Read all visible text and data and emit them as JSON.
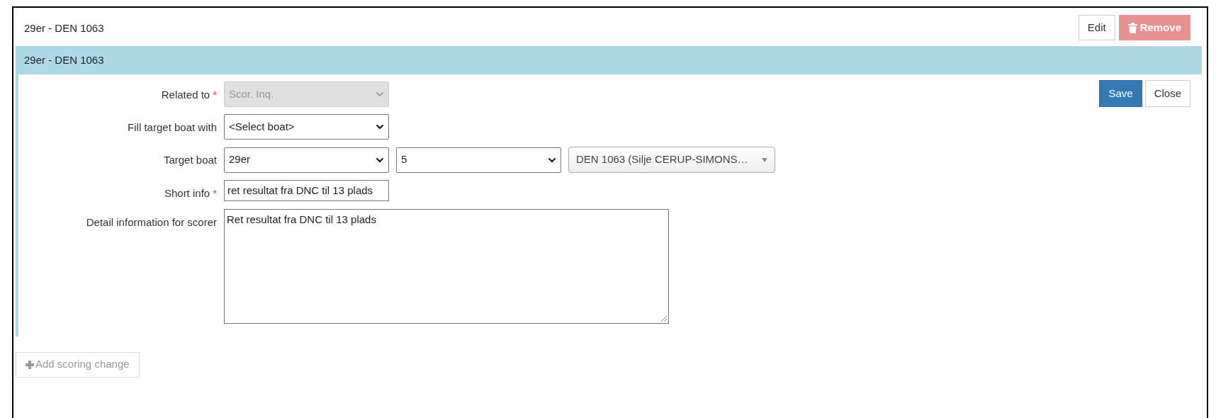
{
  "header": {
    "title": "29er - DEN 1063",
    "buttons": [
      {
        "label": "Edit",
        "kind": "default"
      },
      {
        "label": "Remove",
        "kind": "danger"
      }
    ]
  },
  "panel": {
    "title": "29er - DEN 1063",
    "buttons": [
      {
        "label": "Save",
        "kind": "primary"
      },
      {
        "label": "Close",
        "kind": "default"
      }
    ],
    "fields": [
      {
        "label": "Related to",
        "required_mark": "*",
        "controls": [
          {
            "kind": "select",
            "value": "Scor. Inq.",
            "disabled": true
          }
        ]
      },
      {
        "label": "Fill target boat with",
        "controls": [
          {
            "kind": "select",
            "value": "<Select boat>",
            "disabled": false
          }
        ]
      },
      {
        "label": "Target boat",
        "controls": [
          {
            "kind": "select",
            "value": "29er",
            "disabled": false
          },
          {
            "kind": "select",
            "value": "5",
            "disabled": false
          },
          {
            "kind": "combo",
            "value": "DEN 1063 (Silje CERUP-SIMONS…",
            "disabled": false
          }
        ]
      },
      {
        "label": "Short info",
        "required_mark": "*",
        "controls": [
          {
            "kind": "input",
            "value": "ret resultat fra DNC til 13 plads",
            "disabled": false
          }
        ]
      },
      {
        "label": "Detail information for scorer",
        "controls": [
          {
            "kind": "textarea",
            "value": "Ret resultat fra DNC til 13 plads",
            "disabled": false
          }
        ]
      }
    ]
  },
  "add_button": {
    "label": "Add scoring change"
  }
}
